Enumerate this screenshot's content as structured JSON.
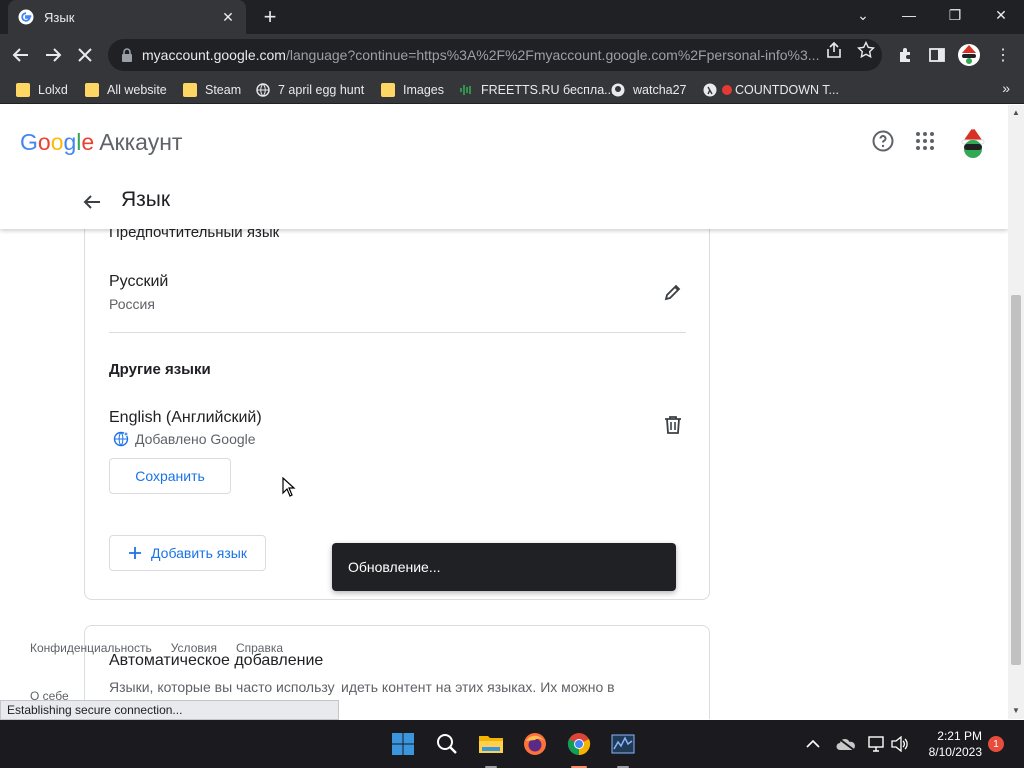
{
  "browser": {
    "tab_title": "Язык",
    "url_domain": "myaccount.google.com",
    "url_path": "/language?continue=https%3A%2F%2Fmyaccount.google.com%2Fpersonal-info%3...",
    "bookmarks": [
      {
        "label": "Lolxd",
        "icon": "folder-icon"
      },
      {
        "label": "All website",
        "icon": "folder-icon"
      },
      {
        "label": "Steam",
        "icon": "folder-icon"
      },
      {
        "label": "7 april egg hunt",
        "icon": "globe-icon"
      },
      {
        "label": "Images",
        "icon": "folder-icon"
      },
      {
        "label": "FREETTS.RU бесплa...",
        "icon": "audio-wave-icon"
      },
      {
        "label": "watcha27",
        "icon": "github-icon"
      },
      {
        "label": "COUNTDOWN T...",
        "icon": "red-dot-icon"
      }
    ],
    "status": "Establishing secure connection..."
  },
  "header": {
    "logo_letters": [
      "G",
      "o",
      "o",
      "g",
      "l",
      "e"
    ],
    "product": "Аккаунт",
    "page_title": "Язык"
  },
  "preferred": {
    "title": "Предпочтительный язык",
    "language": "Русский",
    "region": "Россия"
  },
  "other": {
    "title": "Другие языки",
    "language": "English (Английский)",
    "added_by": "Добавлено Google",
    "save_label": "Сохранить",
    "add_label": "Добавить язык"
  },
  "auto_add": {
    "title": "Автоматическое добавление",
    "text_line1": "Языки, которые вы часто использу",
    "text_line1_tail": "идеть контент на этих языках. Их можно в",
    "text_line2_head": "О себе"
  },
  "footer": {
    "links": [
      "Конфиденциальность",
      "Условия",
      "Справка"
    ],
    "about": "О себе"
  },
  "snackbar": {
    "text": "Обновление..."
  },
  "taskbar": {
    "time": "2:21 PM",
    "date": "8/10/2023",
    "notification_count": "1"
  }
}
